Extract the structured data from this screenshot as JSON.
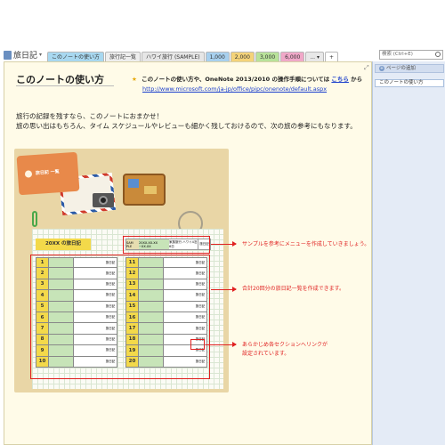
{
  "notebook": {
    "title": "旅日記"
  },
  "tabs": [
    {
      "label": "このノートの使い方",
      "color": "#a8d8f0"
    },
    {
      "label": "旅行記一覧",
      "color": "#eeeeee"
    },
    {
      "label": "ハワイ旅行 (SAMPLE)",
      "color": "#e6e6e6"
    },
    {
      "label": "1,000",
      "color": "#a8d0ee"
    },
    {
      "label": "2,000",
      "color": "#f4d37a"
    },
    {
      "label": "3,000",
      "color": "#b8e29a"
    },
    {
      "label": "6,000",
      "color": "#f0a8c8"
    },
    {
      "label": "... ▾",
      "color": "#e8e8e8"
    },
    {
      "label": "+",
      "color": "#ffffff"
    }
  ],
  "search": {
    "placeholder": "検索 (Ctrl+E)"
  },
  "sidebar": {
    "add_page": "ページの追加",
    "pages": [
      "このノートの使い方"
    ]
  },
  "page": {
    "title": "このノートの使い方",
    "note_prefix": "このノートの使い方や、OneNote 2013/2010 の操作手順については",
    "note_link": "こちら",
    "note_suffix": "から",
    "url": "http://www.microsoft.com/ja-jp/office/pipc/onenote/default.aspx",
    "body_line1": "旅行の記録を残すなら、このノートにおまかせ！",
    "body_line2": "旅の思い出はもちろん、タイム スケジュールやレビューも細かく残しておけるので、次の旅の参考にもなります。"
  },
  "art": {
    "tag_label": "旅日記 一覧",
    "header_label": "20XX の旅日記",
    "sample": {
      "c1": "SAM PLE",
      "c2": "20XX.XX.XX ~XX.XX",
      "c3": "家族旅行 ハワイ4泊6日",
      "c4": "旅日記"
    },
    "row_link": "旅日記",
    "left_numbers": [
      "1",
      "2",
      "3",
      "4",
      "5",
      "6",
      "7",
      "8",
      "9",
      "10"
    ],
    "right_numbers": [
      "11",
      "12",
      "13",
      "14",
      "15",
      "16",
      "17",
      "18",
      "19",
      "20"
    ]
  },
  "annotations": {
    "a1": "サンプルを参考にメニューを作成していきましょう。",
    "a2": "合計20回分の旅日記一覧を作成できます。",
    "a3_line1": "あらかじめ各セクションへリンクが",
    "a3_line2": "設定されています。"
  },
  "colors": {
    "accent_red": "#e02020",
    "link_blue": "#1a3ecc",
    "page_bg": "#fffbe8",
    "sidebar_bg": "#e4ebf6"
  }
}
